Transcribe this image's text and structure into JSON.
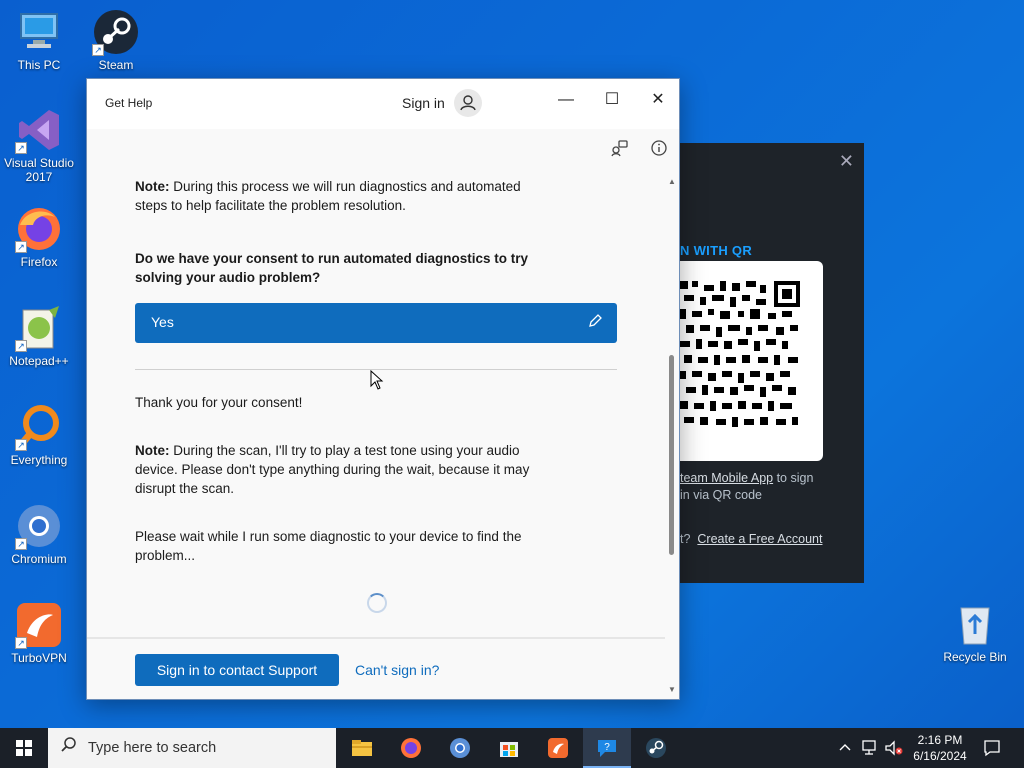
{
  "desktop": {
    "icons": [
      {
        "label": "This PC"
      },
      {
        "label": "Steam"
      },
      {
        "label": "Visual Studio 2017"
      },
      {
        "label": "Firefox"
      },
      {
        "label": "Notepad++"
      },
      {
        "label": "Everything"
      },
      {
        "label": "Chromium"
      },
      {
        "label": "TurboVPN"
      }
    ],
    "recycle_bin": "Recycle Bin"
  },
  "steam_window": {
    "close": "✕",
    "qr_title": "N WITH QR",
    "line1_link": "team Mobile App",
    "line1_rest": " to sign",
    "line2": "in via QR code",
    "line3_pre": "t?",
    "create_link": "Create a Free Account"
  },
  "get_help": {
    "title": "Get Help",
    "sign_in": "Sign in",
    "note1_label": "Note:",
    "note1_text": " During this process we will run diagnostics and automated steps to help facilitate the problem resolution.",
    "question": "Do we have your consent to run automated diagnostics to try solving your audio problem?",
    "answer": "Yes",
    "thanks": "Thank you for your consent!",
    "note2_label": "Note:",
    "note2_text": " During the scan, I'll try to play a test tone using your audio device.  Please don't type anything during the wait, because it may disrupt the scan.",
    "wait_text": "Please wait while I run some diagnostic to your device to find the problem...",
    "contact_button": "Sign in to contact Support",
    "cant_sign_in": "Can't sign in?"
  },
  "taskbar": {
    "search_placeholder": "Type here to search",
    "time": "2:16 PM",
    "date": "6/16/2024",
    "apps": [
      "file-explorer",
      "firefox",
      "chromium",
      "microsoft-store",
      "turbovpn",
      "get-help",
      "steam"
    ]
  },
  "colors": {
    "accent": "#0f6cbd",
    "desktop": "#0b6ad6",
    "taskbar": "#1b2028",
    "steam_bg": "#1e2329"
  }
}
